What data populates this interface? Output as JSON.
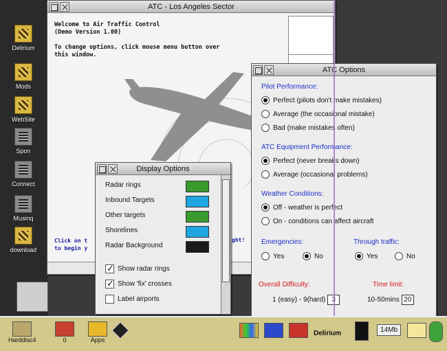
{
  "desktop": {
    "icons": [
      {
        "label": "Delirium",
        "icon": "delirium-icon"
      },
      {
        "label": "Mods",
        "icon": "folder-icon"
      },
      {
        "label": "WebSite",
        "icon": "folder-icon"
      },
      {
        "label": "Spon",
        "icon": "car-icon"
      },
      {
        "label": "Connect",
        "icon": "network-icon"
      },
      {
        "label": "Musinq",
        "icon": "guitar-icon"
      },
      {
        "label": "download",
        "icon": "folder-icon"
      }
    ]
  },
  "atc_window": {
    "title": "ATC - Los Angeles Sector",
    "welcome": "Welcome to Air Traffic Control\n(Demo Version 1.00)\n\nTo change options, click mouse menu button over\nthis window.",
    "bottom_msg": "Click on t\nto begin y",
    "bottom_msg_right": "ght!"
  },
  "display_options": {
    "title": "Display Options",
    "rows": [
      {
        "label": "Radar rings",
        "color": "#3a9a2e"
      },
      {
        "label": "Inbound Targets",
        "color": "#1fa6e0"
      },
      {
        "label": "Other targets",
        "color": "#3a9a2e"
      },
      {
        "label": "Shorelines",
        "color": "#1fa6e0"
      },
      {
        "label": "Radar Background",
        "color": "#1a1a1a"
      }
    ],
    "checks": [
      {
        "label": "Show radar rings",
        "checked": true
      },
      {
        "label": "Show 'fix' crosses",
        "checked": true
      },
      {
        "label": "Label airports",
        "checked": false
      }
    ]
  },
  "atc_options": {
    "title": "ATC Options",
    "pilot_header": "Pilot Performance:",
    "pilot": [
      {
        "label": "Perfect (pilots don't make mistakes)",
        "selected": true
      },
      {
        "label": "Average (the occasional mistake)",
        "selected": false
      },
      {
        "label": "Bad (make mistakes often)",
        "selected": false
      }
    ],
    "equip_header": "ATC Equipment Performance:",
    "equip": [
      {
        "label": "Perfect (never breaks down)",
        "selected": true
      },
      {
        "label": "Average (occasional problems)",
        "selected": false
      }
    ],
    "weather_header": "Weather Conditions:",
    "weather": [
      {
        "label": "Off - weather is perfect",
        "selected": true
      },
      {
        "label": "On - conditions can affect aircraft",
        "selected": false
      }
    ],
    "emergencies_header": "Emergencies:",
    "emergencies": [
      {
        "label": "Yes",
        "selected": false
      },
      {
        "label": "No",
        "selected": true
      }
    ],
    "through_header": "Through traffic:",
    "through": [
      {
        "label": "Yes",
        "selected": true
      },
      {
        "label": "No",
        "selected": false
      }
    ],
    "difficulty_label": "Overall Difficulty:",
    "difficulty_range": "1 (easy) - 9(hard)",
    "difficulty_value": "3",
    "time_label": "Time limit:",
    "time_range": "10-50mins",
    "time_value": "20"
  },
  "iconbar": {
    "items": [
      {
        "label": "Harddisc4",
        "icon": "harddisc-icon"
      },
      {
        "label": "0",
        "icon": "ram-disc-icon"
      },
      {
        "label": "Apps",
        "icon": "apps-icon"
      },
      {
        "label": "",
        "icon": "diamond-icon"
      },
      {
        "label": "",
        "icon": "palette-icon"
      },
      {
        "label": "",
        "icon": "task-icon"
      },
      {
        "label": "Delirium",
        "icon": "delirium-logo-icon"
      },
      {
        "label": "",
        "icon": "font-icon"
      },
      {
        "label": "14Mb",
        "icon": "memory-icon"
      },
      {
        "label": "",
        "icon": "monitor-icon"
      },
      {
        "label": "",
        "icon": "frog-icon"
      }
    ]
  },
  "colors": {
    "section_blue": "#1b2fc8",
    "warning_red": "#d61a1a",
    "iconbar": "#d2c98a"
  }
}
